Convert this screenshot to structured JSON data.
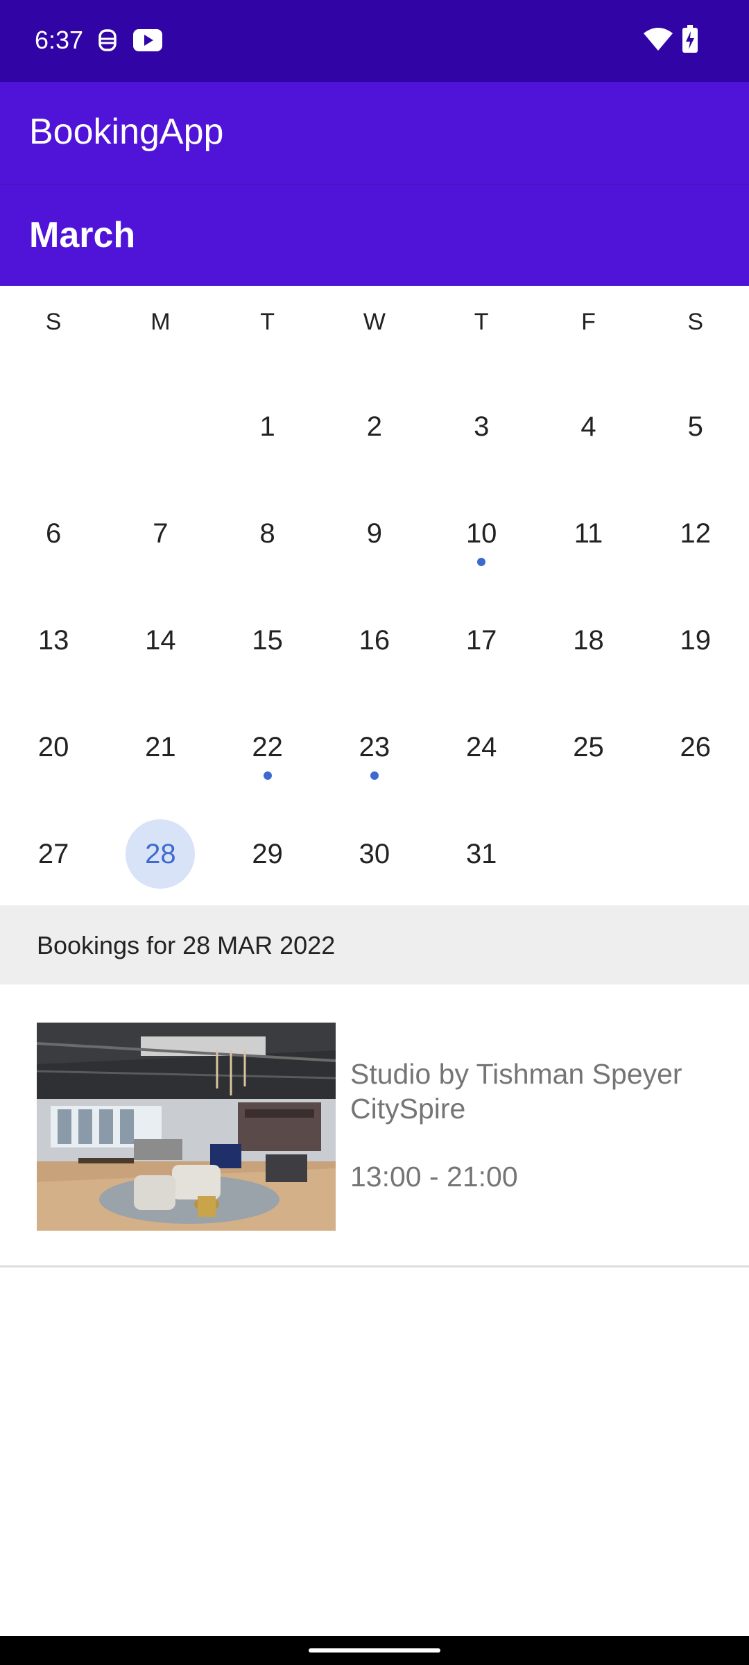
{
  "status_bar": {
    "time": "6:37",
    "icons": [
      "debug-face-icon",
      "youtube-icon",
      "wifi-icon",
      "battery-charging-icon"
    ]
  },
  "app_bar": {
    "title": "BookingApp"
  },
  "calendar": {
    "month": "March",
    "weekdays": [
      "S",
      "M",
      "T",
      "W",
      "T",
      "F",
      "S"
    ],
    "weeks": [
      [
        {
          "d": ""
        },
        {
          "d": ""
        },
        {
          "d": "1"
        },
        {
          "d": "2"
        },
        {
          "d": "3"
        },
        {
          "d": "4"
        },
        {
          "d": "5"
        }
      ],
      [
        {
          "d": "6"
        },
        {
          "d": "7"
        },
        {
          "d": "8"
        },
        {
          "d": "9"
        },
        {
          "d": "10",
          "dot": true
        },
        {
          "d": "11"
        },
        {
          "d": "12"
        }
      ],
      [
        {
          "d": "13"
        },
        {
          "d": "14"
        },
        {
          "d": "15"
        },
        {
          "d": "16"
        },
        {
          "d": "17"
        },
        {
          "d": "18"
        },
        {
          "d": "19"
        }
      ],
      [
        {
          "d": "20"
        },
        {
          "d": "21"
        },
        {
          "d": "22",
          "dot": true
        },
        {
          "d": "23",
          "dot": true
        },
        {
          "d": "24"
        },
        {
          "d": "25"
        },
        {
          "d": "26"
        }
      ],
      [
        {
          "d": "27"
        },
        {
          "d": "28",
          "selected": true
        },
        {
          "d": "29"
        },
        {
          "d": "30"
        },
        {
          "d": "31"
        },
        {
          "d": ""
        },
        {
          "d": ""
        }
      ]
    ],
    "accent_color": "#3e6ad0",
    "selected_bg_color": "#d8e3f8"
  },
  "bookings": {
    "header": "Bookings for 28 MAR 2022",
    "items": [
      {
        "name": "Studio by Tishman Speyer CitySpire",
        "time": "13:00 - 21:00",
        "image": "office-lounge-photo"
      }
    ]
  },
  "colors": {
    "status_bar": "#3004a5",
    "app_bar": "#5014d8"
  }
}
